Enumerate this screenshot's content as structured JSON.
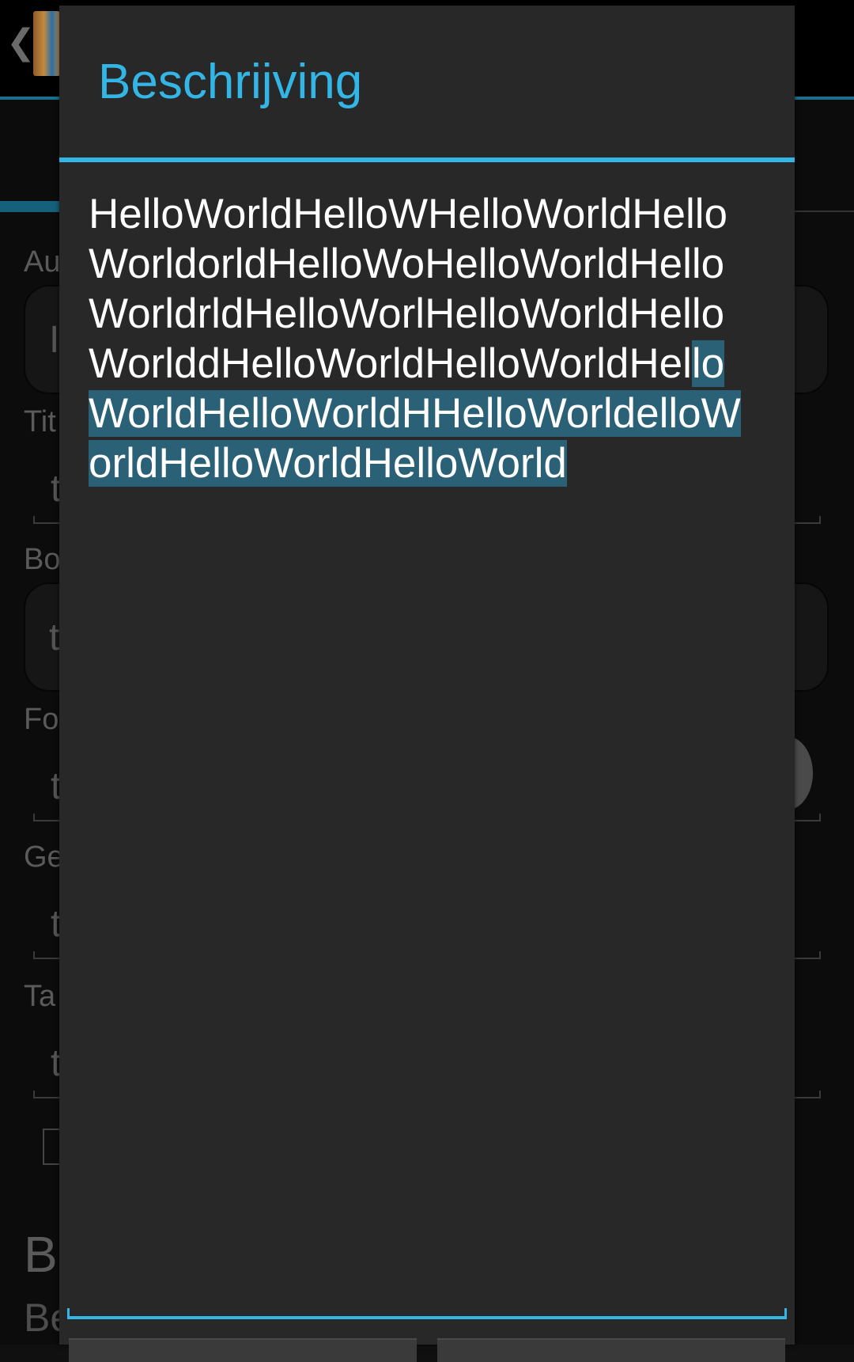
{
  "background": {
    "back_glyph": "❮",
    "labels": [
      "Au",
      "Tit",
      "Bo",
      "Fo",
      "Ge",
      "Ta"
    ],
    "field_hints": [
      "I",
      "t",
      "t",
      "t",
      "t",
      "t"
    ],
    "bottom_big": "Be",
    "bottom_small": "Be"
  },
  "dialog": {
    "title": "Beschrijving",
    "text_lines": [
      {
        "plain": "HelloWorldHelloWHelloWorldHello",
        "selected": ""
      },
      {
        "plain": "WorldorldHelloWoHelloWorldHello",
        "selected": ""
      },
      {
        "plain": "WorldrldHelloWorlHelloWorldHello",
        "selected": ""
      },
      {
        "plain": "WorlddHelloWorldHelloWorldHel",
        "selected": "lo"
      },
      {
        "plain": "",
        "selected": "WorldHelloWorldHHelloWorldelloW"
      },
      {
        "plain": "",
        "selected": "orldHelloWorldHelloWorld"
      }
    ]
  },
  "colors": {
    "accent": "#33b5e5",
    "dialog_bg": "#282828",
    "selection": "#2a6176"
  }
}
